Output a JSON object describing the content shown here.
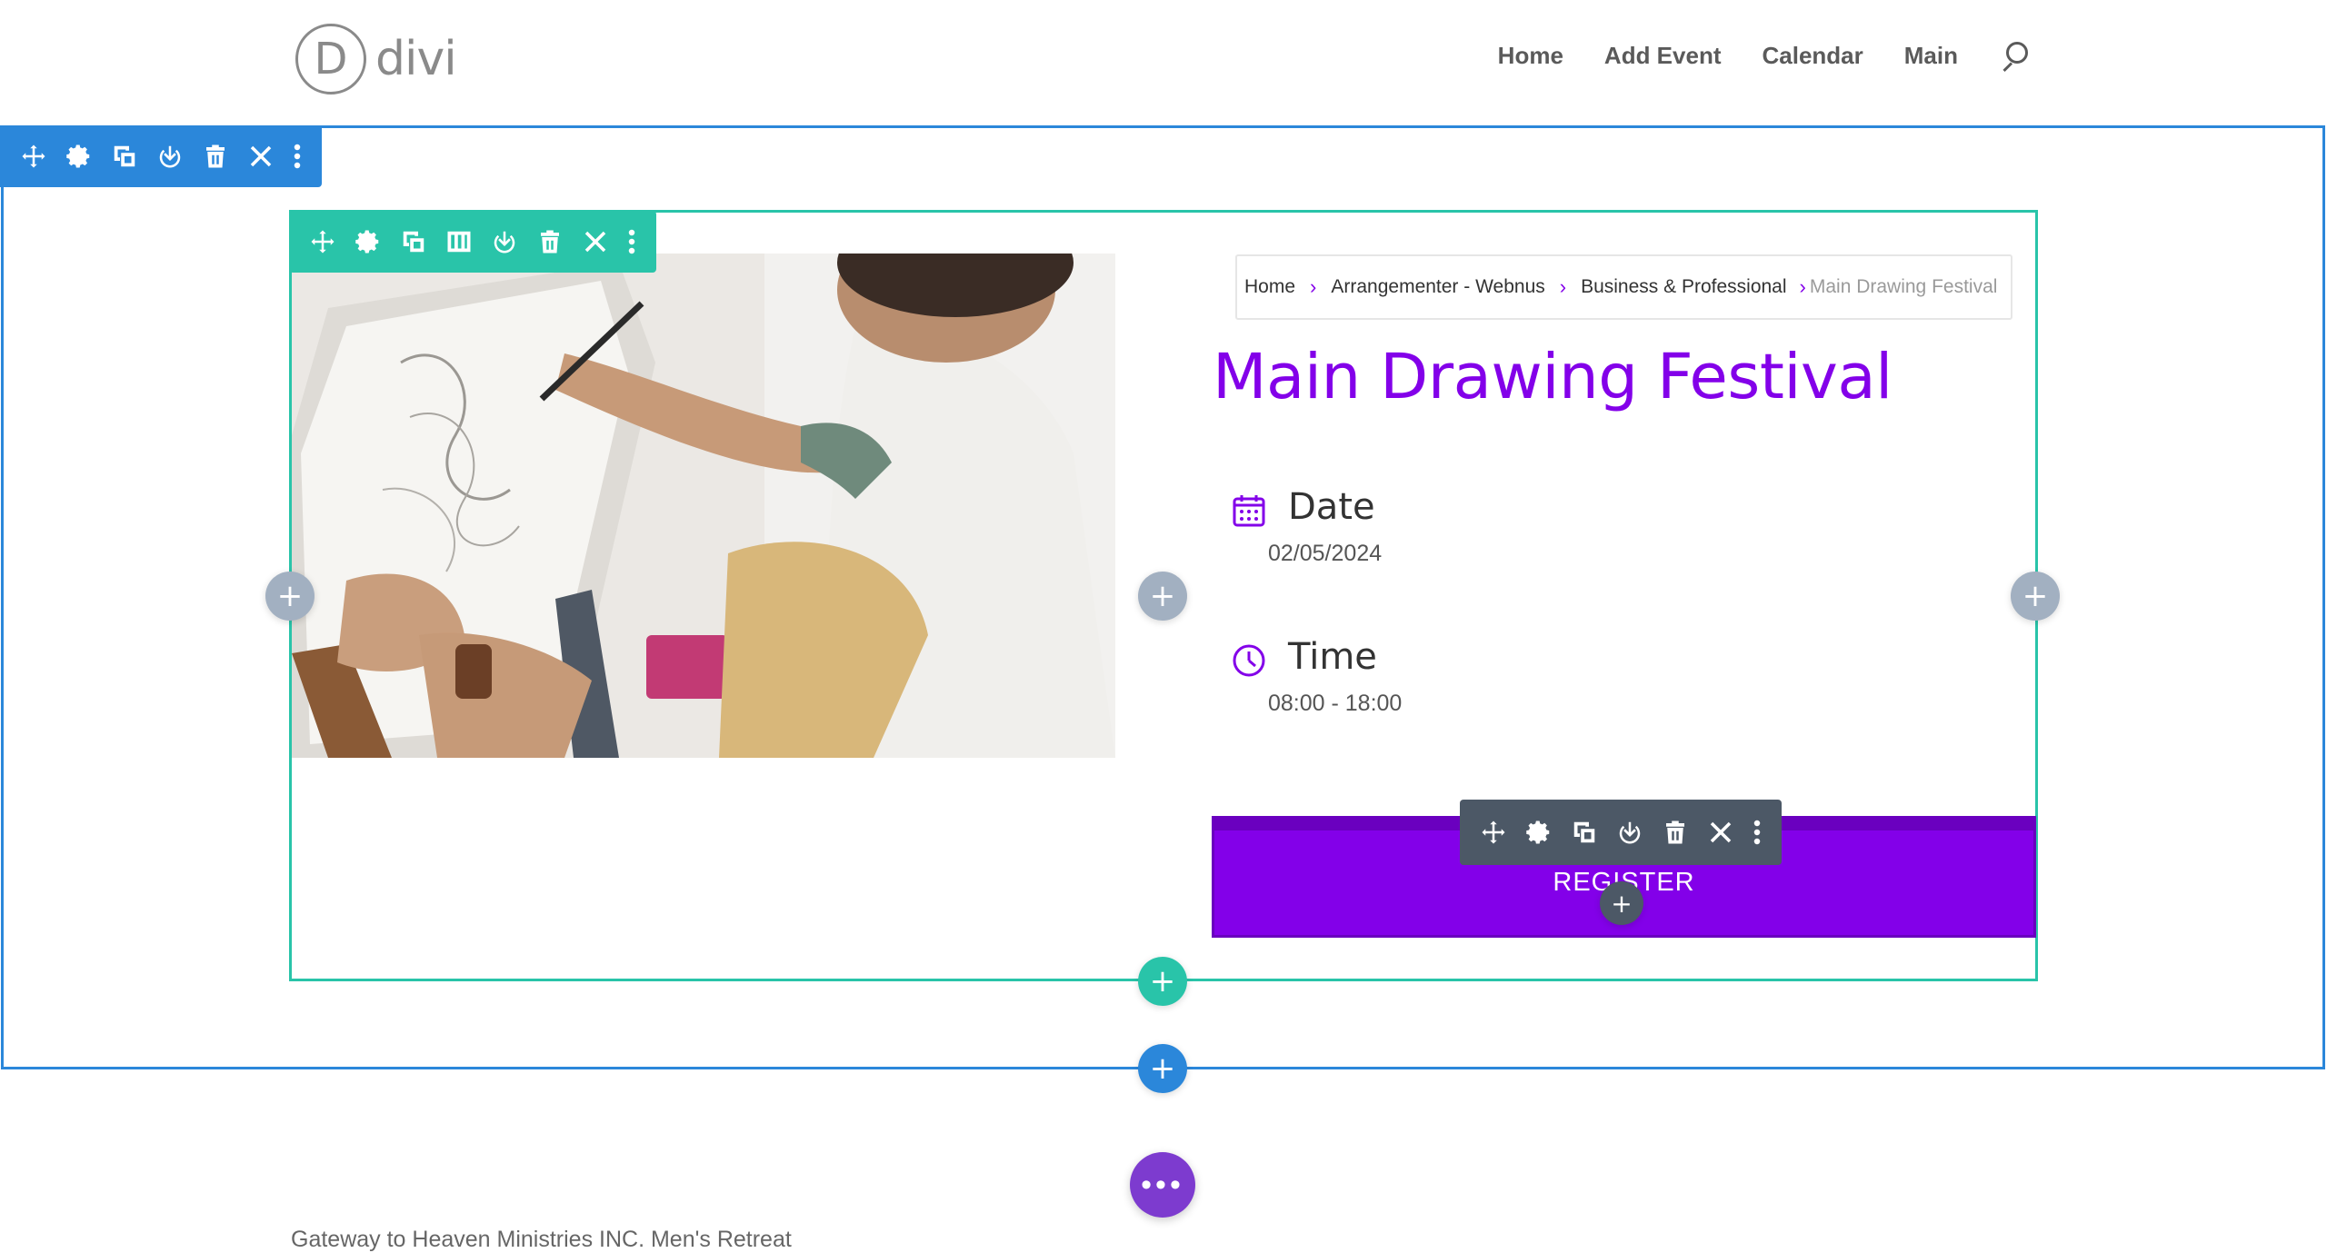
{
  "header": {
    "logo_letter": "D",
    "logo_text": "divi",
    "nav": [
      "Home",
      "Add Event",
      "Calendar",
      "Main"
    ]
  },
  "breadcrumb": {
    "items": [
      "Home",
      "Arrangementer - Webnus",
      "Business & Professional"
    ],
    "current": "Main Drawing Festival"
  },
  "event": {
    "title": "Main Drawing Festival",
    "date_label": "Date",
    "date_value": "02/05/2024",
    "time_label": "Time",
    "time_value": "08:00 - 18:00",
    "register_label": "REGISTER"
  },
  "builder": {
    "add_symbol": "+",
    "more_symbol": "•••"
  },
  "footer": {
    "text": "Gateway to Heaven Ministries INC. Men's Retreat"
  },
  "colors": {
    "accent": "#8300e9",
    "section_outline": "#2b87da",
    "row_outline": "#29c4a9",
    "module_toolbar": "#4c5866",
    "fab": "#7d3bcf"
  }
}
